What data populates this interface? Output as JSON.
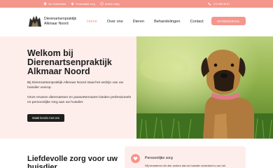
{
  "topbar": {
    "location": "Hs. Dobrestraat",
    "specialty": "Persoonlijke zorg",
    "hours": "Unieke uitleg",
    "phone": "072 555 38 67"
  },
  "header": {
    "brand_line1": "Dierenartsenpraktijk",
    "brand_line2": "Alkmaar Noord",
    "nav": [
      "Home",
      "Over ons",
      "Dieren",
      "Behandelingen",
      "Contact"
    ],
    "cta": "SPOEDGEVAL"
  },
  "hero": {
    "title": "Welkom bij Dierenartsenpraktijk Alkmaar Noord",
    "p1": "Bij Dierenartsenpraktijk Alkmaar Noord staat het welzijn van uw huisdier voorop.",
    "p2": "Onze ervaren dierenartsen en paravetennairen bieden professionele en persoonlijke zorg aan uw huisdier.",
    "button": "Maak kennis met ons"
  },
  "section": {
    "title": "Liefdevolle zorg voor uw huisdier",
    "card_title": "Persoonlijke zorg",
    "card_text": "Wij benaderen elk dier anders dat uw huisdier onderdeel is van het"
  },
  "colors": {
    "accent": "#f4968c",
    "hero_bg": "#fdeeec",
    "dark": "#1e1e1e"
  }
}
